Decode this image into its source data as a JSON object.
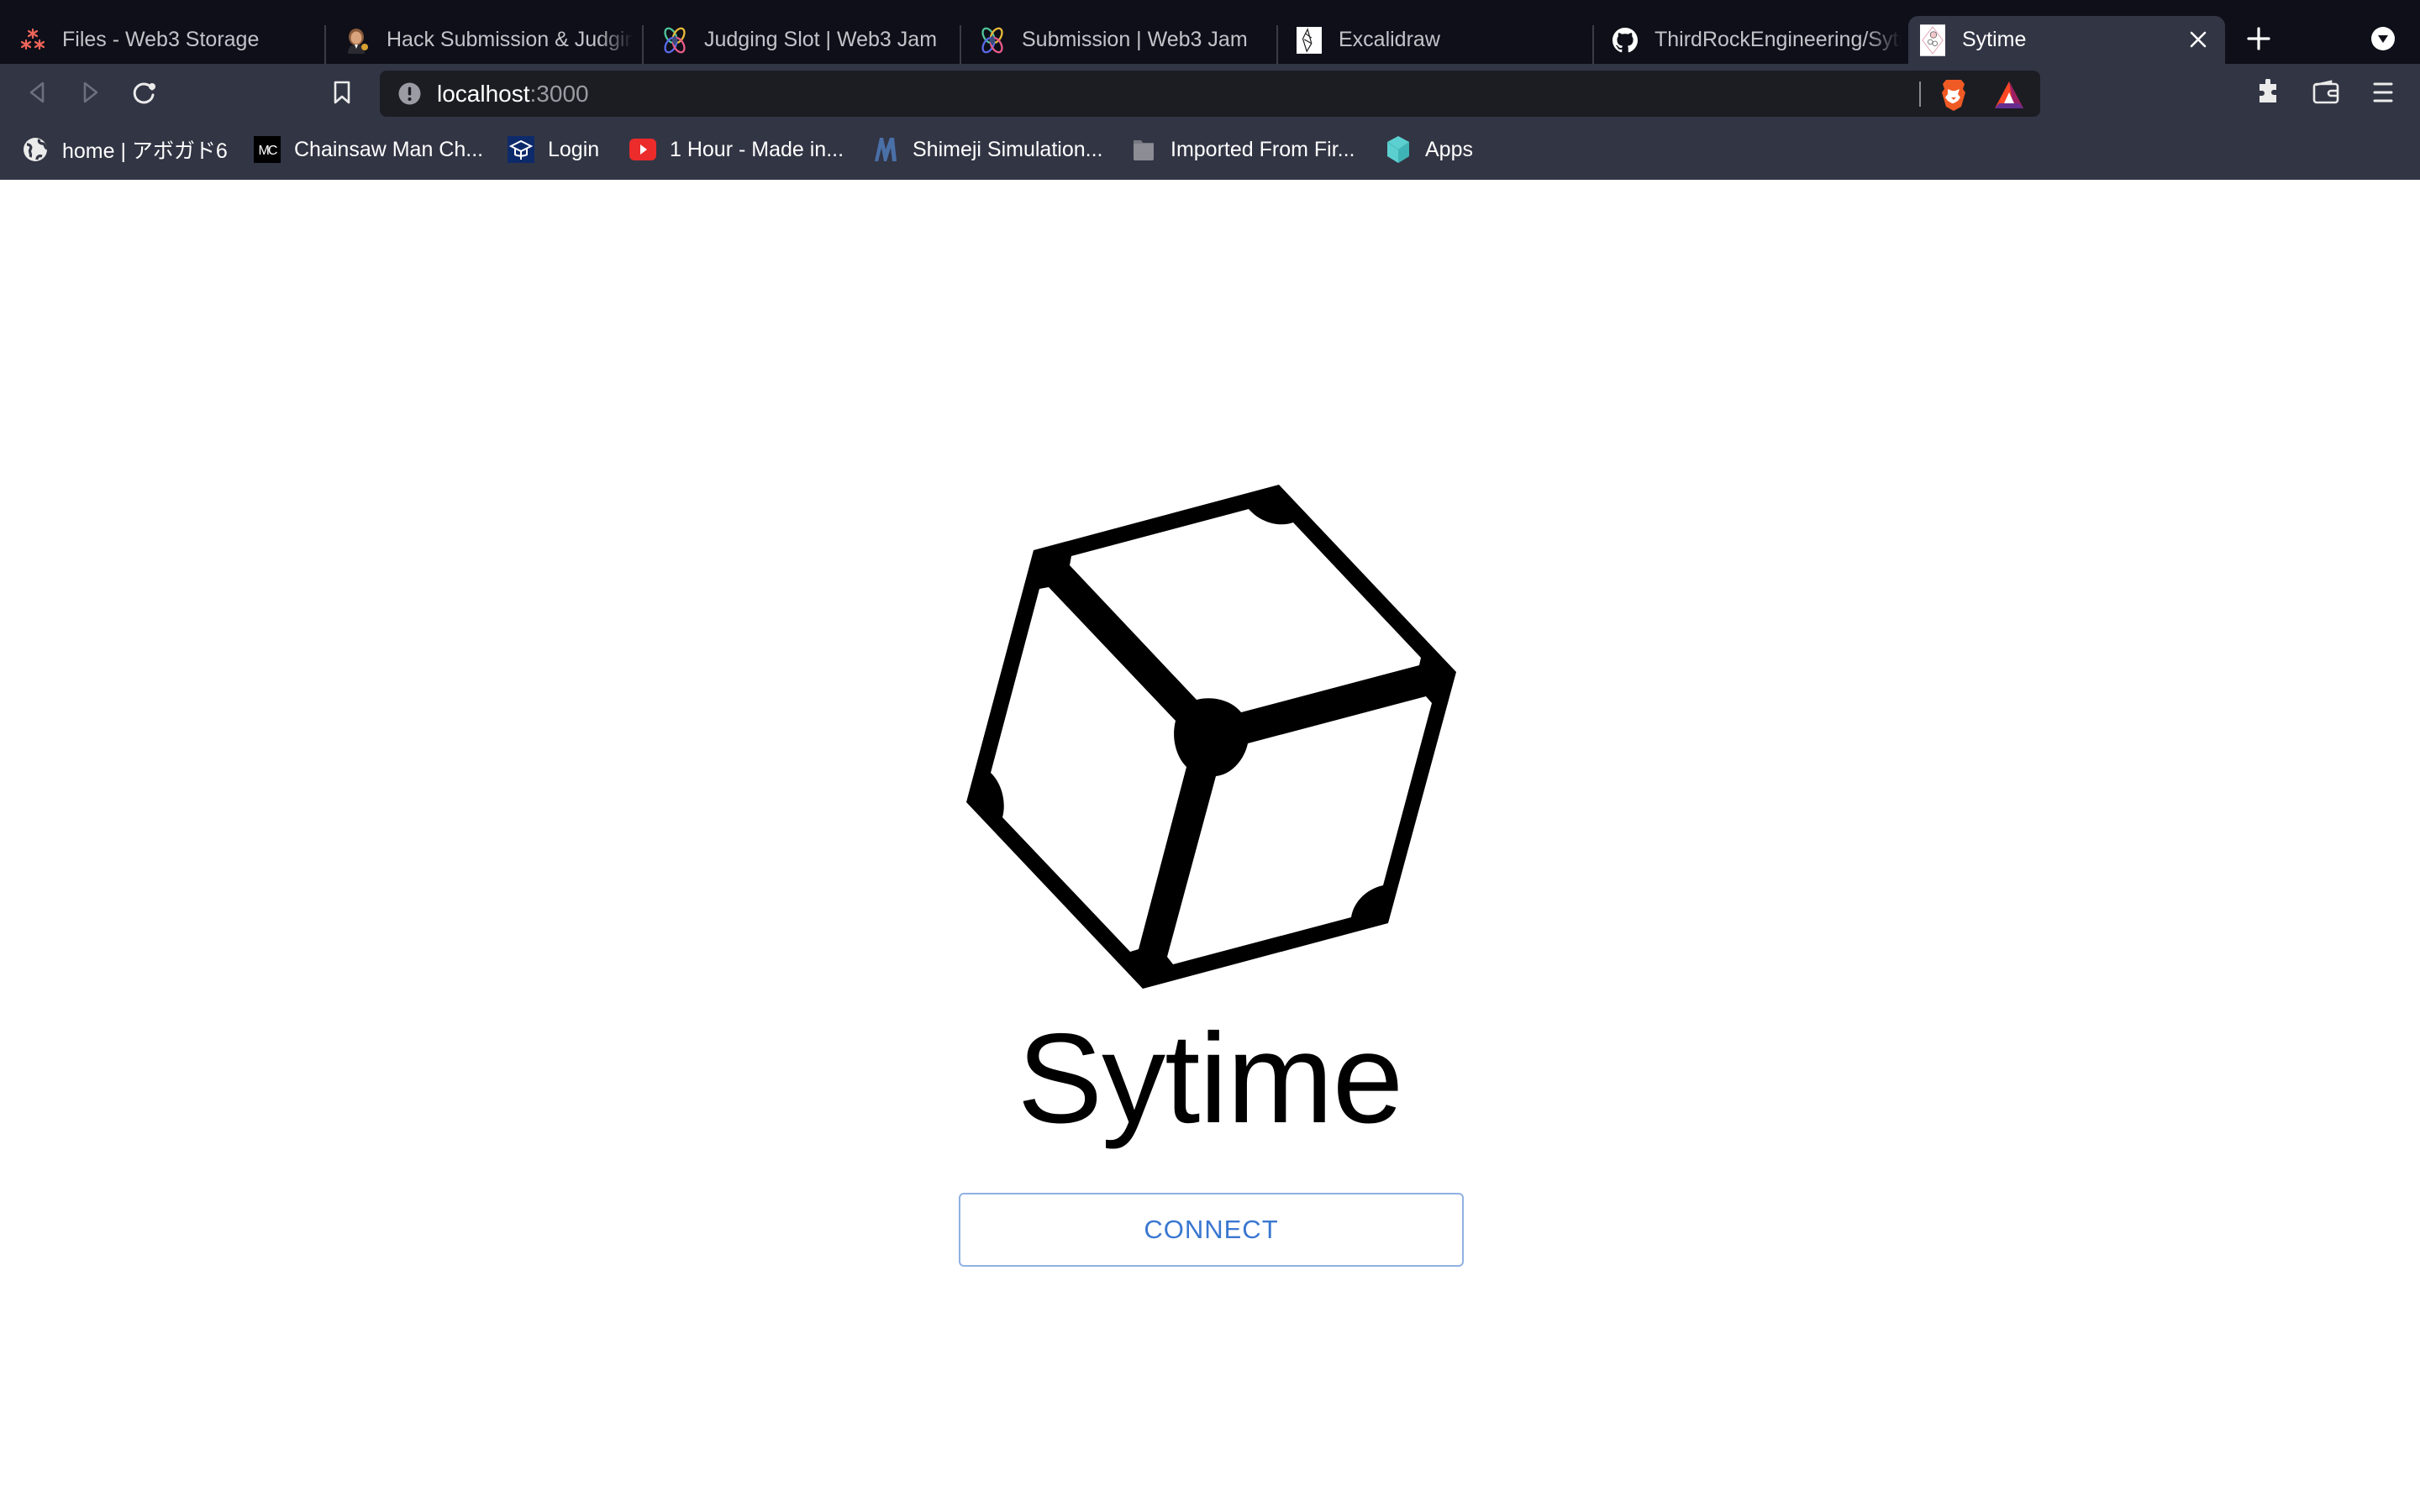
{
  "browser": {
    "tabs": [
      {
        "title": "Files - Web3 Storage",
        "favicon": "web3-storage-icon",
        "active": false
      },
      {
        "title": "Hack Submission & Judging",
        "favicon": "judge-emoji-icon",
        "active": false
      },
      {
        "title": "Judging Slot | Web3 Jam",
        "favicon": "web3-jam-icon",
        "active": false
      },
      {
        "title": "Submission | Web3 Jam",
        "favicon": "web3-jam-icon",
        "active": false
      },
      {
        "title": "Excalidraw",
        "favicon": "excalidraw-icon",
        "active": false
      },
      {
        "title": "ThirdRockEngineering/Sytime",
        "favicon": "github-icon",
        "active": false
      },
      {
        "title": "Sytime",
        "favicon": "sytime-icon",
        "active": true
      }
    ],
    "address_bar": {
      "host": "localhost",
      "port": ":3000",
      "security_icon": "info-icon"
    },
    "toolbar_icons": [
      "back-icon",
      "forward-icon",
      "reload-icon",
      "bookmark-icon",
      "brave-shields-icon",
      "brave-rewards-icon",
      "extensions-icon",
      "wallet-icon",
      "menu-icon"
    ],
    "bookmarks": [
      {
        "label": "home | アボガド6",
        "icon": "globe-icon"
      },
      {
        "label": "Chainsaw Man Ch...",
        "icon": "mc-icon"
      },
      {
        "label": "Login",
        "icon": "graduation-cap-icon"
      },
      {
        "label": "1 Hour - Made in...",
        "icon": "youtube-icon"
      },
      {
        "label": "Shimeji Simulation...",
        "icon": "m-logo-icon"
      },
      {
        "label": "Imported From Fir...",
        "icon": "folder-icon"
      },
      {
        "label": "Apps",
        "icon": "apps-cube-icon"
      }
    ]
  },
  "page": {
    "app_name": "Sytime",
    "logo": "cube-logo",
    "connect_button": "CONNECT"
  },
  "colors": {
    "tab_strip_bg": "#0e0f18",
    "toolbar_bg": "#323544",
    "omnibox_bg": "#1c1d23",
    "button_text": "#3a77d0",
    "button_border": "#8fb1e3"
  }
}
